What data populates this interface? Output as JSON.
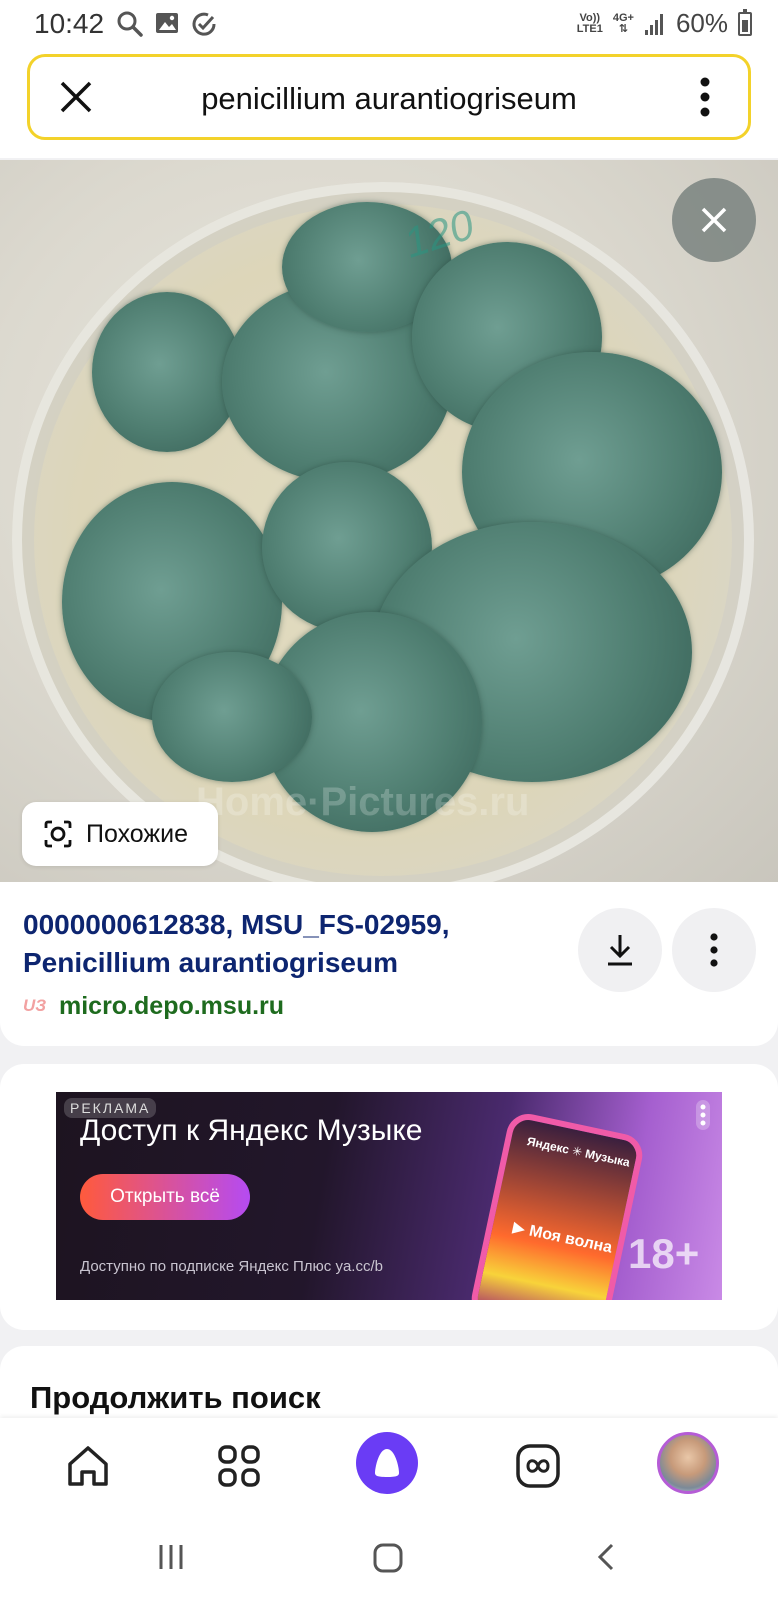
{
  "status_bar": {
    "time": "10:42",
    "network_top": "Vo))",
    "network_bottom": "LTE1",
    "network_type": "4G+",
    "battery_percent": "60%",
    "icons": [
      "search-icon",
      "gallery-icon",
      "check-circle-icon",
      "signal-icon",
      "battery-icon"
    ]
  },
  "search": {
    "query": "penicillium aurantiogriseum"
  },
  "image_viewer": {
    "plate_marking": "120",
    "watermark": "Home·Pictures.ru",
    "similar_label": "Похожие"
  },
  "result": {
    "title": "0000000612838, MSU_FS-02959, Penicillium aurantiogriseum",
    "favicon_text": "UЗ",
    "domain": "micro.depo.msu.ru"
  },
  "ad": {
    "tag": "РЕКЛАМА",
    "headline": "Доступ к Яндекс Музыке",
    "cta": "Открыть всё",
    "fine_print": "Доступно по подписке Яндекс Плюс ya.cc/b",
    "age_rating": "18+",
    "phone_brand": "Яндекс ✳ Музыка",
    "phone_wave": "▶ Моя волна"
  },
  "continue": {
    "title": "Продолжить поиск"
  },
  "bottom_nav": {
    "items": [
      "home-icon",
      "apps-grid-icon",
      "alice-icon",
      "infinity-icon",
      "profile-avatar"
    ]
  },
  "colors": {
    "search_border": "#f3d22a",
    "title_link": "#0d2570",
    "domain_green": "#1e6b1e",
    "alice_purple": "#6a3cf5"
  }
}
